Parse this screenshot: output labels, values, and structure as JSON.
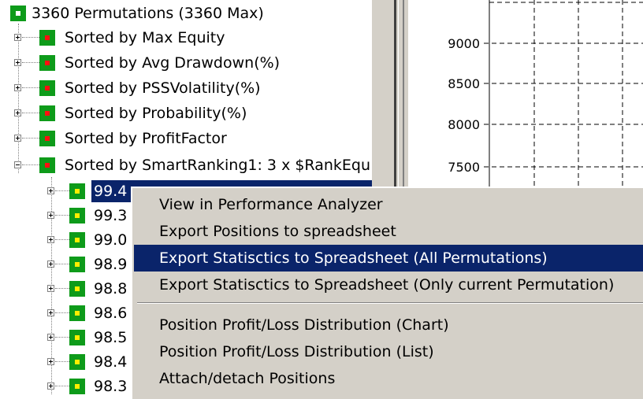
{
  "tree": {
    "root": {
      "label": "3360 Permutations (3360 Max)",
      "icon": "white"
    },
    "groups": [
      {
        "label": "Sorted by Max Equity",
        "icon": "red"
      },
      {
        "label": "Sorted by Avg Drawdown(%)",
        "icon": "red"
      },
      {
        "label": "Sorted by PSSVolatility(%)",
        "icon": "red"
      },
      {
        "label": "Sorted by Probability(%)",
        "icon": "red"
      },
      {
        "label": "Sorted by ProfitFactor",
        "icon": "red"
      },
      {
        "label": "Sorted by SmartRanking1: 3 x $RankEqu",
        "icon": "red"
      }
    ],
    "children": [
      {
        "label": "99.4",
        "icon": "yellow",
        "selected": true
      },
      {
        "label": "99.3",
        "icon": "yellow"
      },
      {
        "label": "99.0",
        "icon": "yellow"
      },
      {
        "label": "98.9",
        "icon": "yellow"
      },
      {
        "label": "98.8",
        "icon": "yellow"
      },
      {
        "label": "98.6",
        "icon": "yellow"
      },
      {
        "label": "98.5",
        "icon": "yellow"
      },
      {
        "label": "98.4",
        "icon": "yellow"
      },
      {
        "label": "98.3",
        "icon": "yellow"
      }
    ]
  },
  "chart": {
    "y_ticks": [
      "9000",
      "8500",
      "8000",
      "7500"
    ]
  },
  "context_menu": {
    "items": [
      {
        "label": "View in Performance Analyzer"
      },
      {
        "label": "Export Positions to spreadsheet"
      },
      {
        "label": "Export Statisctics to Spreadsheet (All Permutations)",
        "highlighted": true
      },
      {
        "label": "Export Statisctics to Spreadsheet (Only current Permutation)"
      },
      {
        "separator": true
      },
      {
        "label": "Position Profit/Loss Distribution (Chart)"
      },
      {
        "label": "Position Profit/Loss Distribution (List)"
      },
      {
        "label": "Attach/detach Positions"
      }
    ]
  },
  "colors": {
    "node_green": "#0e9b1a",
    "selection": "#0a246a",
    "menu_bg": "#d4d0c8"
  }
}
